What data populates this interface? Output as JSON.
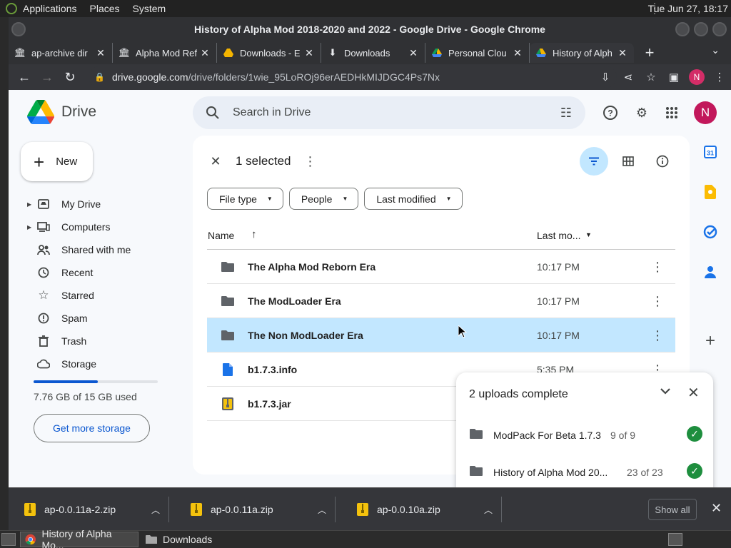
{
  "top_panel": {
    "menus": [
      "Applications",
      "Places",
      "System"
    ],
    "clock": "Tue Jun 27, 18:17"
  },
  "window": {
    "title": "History of Alpha Mod 2018-2020 and 2022 - Google Drive - Google Chrome"
  },
  "tabs": [
    {
      "title": "ap-archive dir",
      "icon": "archive-icon"
    },
    {
      "title": "Alpha Mod Ref",
      "icon": "archive-icon"
    },
    {
      "title": "Downloads - E",
      "icon": "gdrive-icon"
    },
    {
      "title": "Downloads",
      "icon": "download-icon"
    },
    {
      "title": "Personal Clou",
      "icon": "gdrive-icon"
    },
    {
      "title": "History of Alph",
      "icon": "gdrive-icon",
      "active": true
    }
  ],
  "address": {
    "host": "drive.google.com",
    "path": "/drive/folders/1wie_95LoROj96erAEDHkMIJDGC4Ps7Nx"
  },
  "profile_initial": "N",
  "drive": {
    "product_name": "Drive",
    "search_placeholder": "Search in Drive",
    "new_label": "New",
    "nav": [
      {
        "label": "My Drive",
        "icon": "my-drive-icon",
        "expandable": true
      },
      {
        "label": "Computers",
        "icon": "computers-icon",
        "expandable": true
      },
      {
        "label": "Shared with me",
        "icon": "shared-icon"
      },
      {
        "label": "Recent",
        "icon": "clock-icon"
      },
      {
        "label": "Starred",
        "icon": "star-icon"
      },
      {
        "label": "Spam",
        "icon": "spam-icon"
      },
      {
        "label": "Trash",
        "icon": "trash-icon"
      },
      {
        "label": "Storage",
        "icon": "cloud-icon"
      }
    ],
    "storage": {
      "used_text": "7.76 GB of 15 GB used",
      "fraction_used": 0.517,
      "cta": "Get more storage"
    },
    "selection": {
      "count_text": "1 selected"
    },
    "filters": [
      "File type",
      "People",
      "Last modified"
    ],
    "columns": {
      "name": "Name",
      "modified": "Last mo..."
    },
    "files": [
      {
        "name": "The Alpha Mod Reborn Era",
        "modified": "10:17 PM",
        "type": "folder",
        "selected": false
      },
      {
        "name": "The ModLoader Era",
        "modified": "10:17 PM",
        "type": "folder",
        "selected": false
      },
      {
        "name": "The Non ModLoader Era",
        "modified": "10:17 PM",
        "type": "folder",
        "selected": true
      },
      {
        "name": "b1.7.3.info",
        "modified": "5:35 PM",
        "type": "doc",
        "selected": false
      },
      {
        "name": "b1.7.3.jar",
        "modified": "",
        "type": "zip",
        "selected": false
      }
    ],
    "uploads": {
      "title": "2 uploads complete",
      "items": [
        {
          "name": "ModPack For Beta 1.7.3",
          "count": "9 of 9"
        },
        {
          "name": "History of Alpha Mod 20...",
          "count": "23 of 23"
        }
      ]
    },
    "colors": {
      "accent": "#0b57d0",
      "selected_row": "#c2e7ff",
      "avatar": "#c2185b"
    }
  },
  "downloads": {
    "items": [
      "ap-0.0.11a-2.zip",
      "ap-0.0.11a.zip",
      "ap-0.0.10a.zip"
    ],
    "show_all": "Show all"
  },
  "taskbar": {
    "tasks": [
      {
        "label": "History of Alpha Mo...",
        "active": true
      },
      {
        "label": "Downloads",
        "active": false
      }
    ]
  }
}
